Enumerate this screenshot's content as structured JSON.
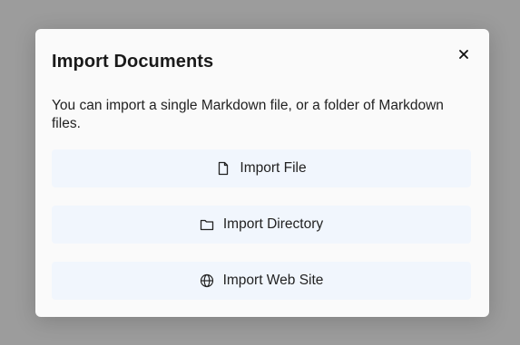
{
  "dialog": {
    "title": "Import Documents",
    "description": "You can import a single Markdown file, or a folder of Markdown files.",
    "close_icon": "close-icon",
    "options": [
      {
        "label": "Import File",
        "icon": "file-icon"
      },
      {
        "label": "Import Directory",
        "icon": "folder-icon"
      },
      {
        "label": "Import Web Site",
        "icon": "globe-icon"
      }
    ]
  },
  "colors": {
    "backdrop": "#9c9c9c",
    "dialog_bg": "#fafafa",
    "option_bg": "#f1f6fd",
    "text": "#222222"
  }
}
